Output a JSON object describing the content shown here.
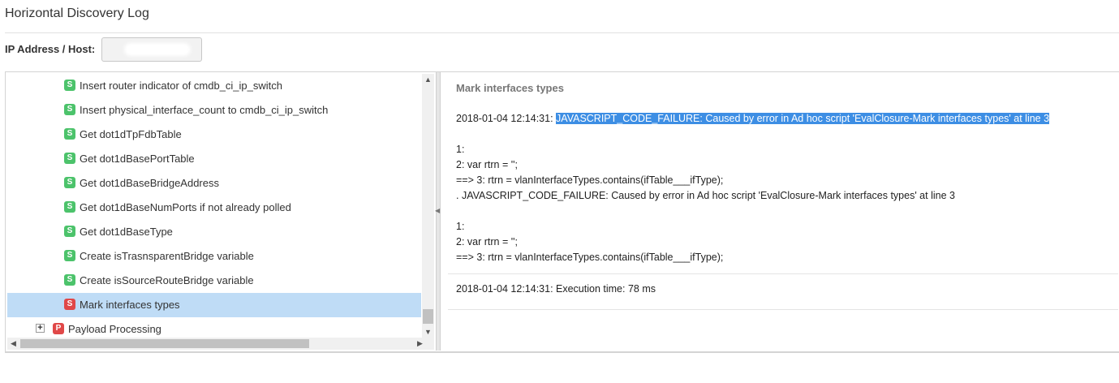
{
  "page": {
    "title": "Horizontal Discovery Log"
  },
  "ip": {
    "label": "IP Address / Host:",
    "value": ""
  },
  "tree": {
    "items": [
      {
        "badge": "S",
        "label": "Insert router indicator of cmdb_ci_ip_switch",
        "status": "success"
      },
      {
        "badge": "S",
        "label": "Insert physical_interface_count to cmdb_ci_ip_switch",
        "status": "success"
      },
      {
        "badge": "S",
        "label": "Get dot1dTpFdbTable",
        "status": "success"
      },
      {
        "badge": "S",
        "label": "Get dot1dBasePortTable",
        "status": "success"
      },
      {
        "badge": "S",
        "label": "Get dot1dBaseBridgeAddress",
        "status": "success"
      },
      {
        "badge": "S",
        "label": "Get dot1dBaseNumPorts if not already polled",
        "status": "success"
      },
      {
        "badge": "S",
        "label": "Get dot1dBaseType",
        "status": "success"
      },
      {
        "badge": "S",
        "label": "Create isTrasnsparentBridge variable",
        "status": "success"
      },
      {
        "badge": "S",
        "label": "Create isSourceRouteBridge variable",
        "status": "success"
      },
      {
        "badge": "S",
        "label": "Mark interfaces types",
        "status": "error",
        "selected": true
      }
    ],
    "payload": {
      "expander": "+",
      "badge": "P",
      "label": "Payload Processing"
    }
  },
  "detail": {
    "title": "Mark interfaces types",
    "log_prefix": "2018-01-04 12:14:31: ",
    "log_highlight": "JAVASCRIPT_CODE_FAILURE: Caused by error in Ad hoc script 'EvalClosure-Mark interfaces types' at line 3",
    "log_body": "\n\n1:\n2: var rtrn = '';\n==> 3: rtrn = vlanInterfaceTypes.contains(ifTable___ifType);\n. JAVASCRIPT_CODE_FAILURE: Caused by error in Ad hoc script 'EvalClosure-Mark interfaces types' at line 3\n\n1:\n2: var rtrn = '';\n==> 3: rtrn = vlanInterfaceTypes.contains(ifTable___ifType);",
    "execution": "2018-01-04 12:14:31: Execution time: 78 ms"
  },
  "colors": {
    "success_badge": "#4cc36b",
    "error_badge": "#e04848",
    "payload_badge": "#e04848",
    "selected_row": "#bfdcf6",
    "highlight": "#3d8ee4"
  },
  "icons": {
    "scroll_up": "chevron-up-icon",
    "scroll_down": "chevron-down-icon",
    "scroll_left": "chevron-left-icon",
    "scroll_right": "chevron-right-icon",
    "splitter": "collapse-left-icon"
  }
}
